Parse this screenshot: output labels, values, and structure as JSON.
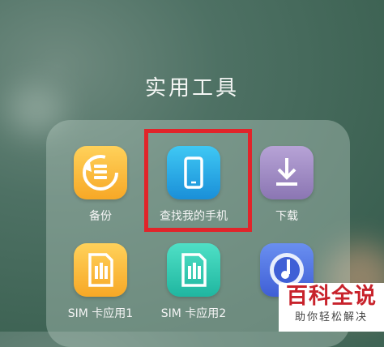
{
  "folder": {
    "title": "实用工具",
    "apps": [
      {
        "label": "备份",
        "icon": "backup-icon"
      },
      {
        "label": "查找我的手机",
        "icon": "find-my-phone-icon"
      },
      {
        "label": "下载",
        "icon": "download-icon"
      },
      {
        "label": "SIM 卡应用1",
        "icon": "sim-card-icon"
      },
      {
        "label": "SIM 卡应用2",
        "icon": "sim-card-icon"
      },
      {
        "label": "",
        "icon": "music-icon"
      }
    ]
  },
  "watermark": {
    "main": "百科全说",
    "sub": "助你轻松解决"
  },
  "colors": {
    "highlight": "#e1242a",
    "watermark_red": "#c8232c"
  }
}
